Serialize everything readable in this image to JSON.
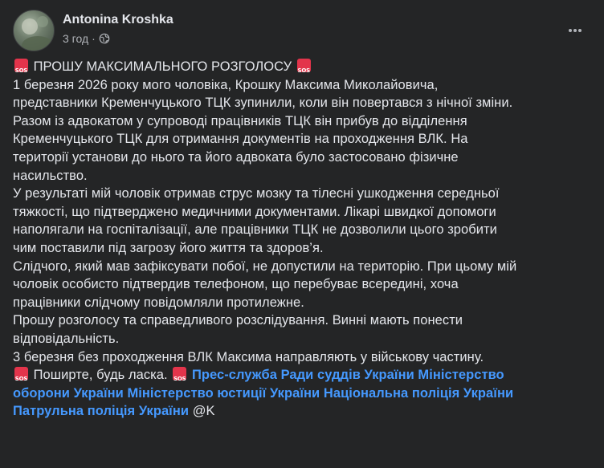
{
  "post": {
    "author": "Antonina Kroshka",
    "time": "3 год",
    "separator": "·",
    "icons": {
      "avatar": "profile-photo",
      "audience": "globe-icon",
      "menu": "more-options-icon",
      "emoji": "sos-button-emoji"
    },
    "colors": {
      "background": "#242526",
      "text": "#e4e6eb",
      "secondary_text": "#b0b3b8",
      "link": "#4599ff",
      "sos_emoji": "#e3344b"
    },
    "title_text": "ПРОШУ МАКСИМАЛЬНОГО РОЗГОЛОСУ",
    "lines": [
      "1 березня 2026 року мого чоловіка, Крошку Максима Миколайовича,",
      "представники Кременчуцького ТЦК зупинили, коли він повертався з нічної зміни.",
      "Разом із адвокатом у супроводі працівників ТЦК  він прибув до відділення",
      "Кременчуцького ТЦК для отримання документів на проходження ВЛК. На",
      "території установи до нього та його адвоката було застосовано фізичне",
      "насильство.",
      "У результаті мій чоловік отримав струс мозку та тілесні ушкодження середньої",
      "тяжкості, що підтверджено медичними документами. Лікарі швидкої допомоги",
      "наполягали на госпіталізації, але працівники ТЦК не дозволили цього зробити",
      "чим поставили під загрозу його життя та здоров’я.",
      "Слідчого, який мав зафіксувати побої, не допустили на територію. При цьому мій",
      "чоловік особисто підтвердив телефоном, що перебуває всередині, хоча",
      "працівники слідчому повідомляли протилежне.",
      "Прошу розголосу та справедливого розслідування. Винні мають понести",
      "відповідальність.",
      "3 березня без проходження ВЛК Максима направляють у військову частину."
    ],
    "share_text": "Поширте, будь ласка.",
    "tags": {
      "line1": "Прес-служба Ради суддів України Міністерство",
      "line2": "оборони України Міністерство юстиції України Національна поліція України",
      "line3": "Патрульна поліція України"
    },
    "mention_suffix": "@K"
  }
}
